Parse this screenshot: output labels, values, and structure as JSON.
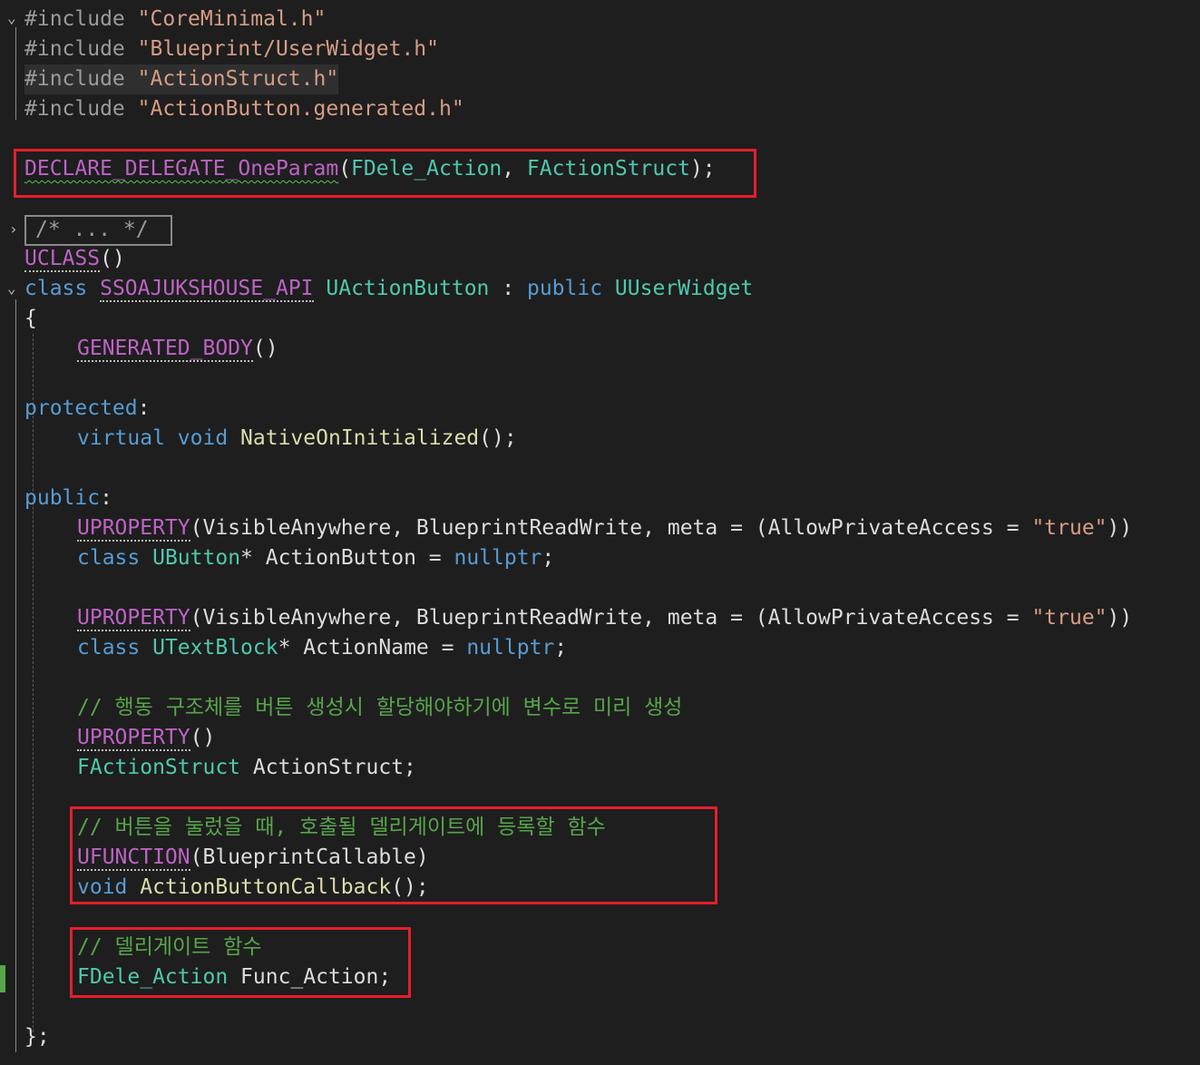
{
  "editor": {
    "include_keyword": "#include",
    "includes": [
      "\"CoreMinimal.h\"",
      "\"Blueprint/UserWidget.h\"",
      "\"ActionStruct.h\"",
      "\"ActionButton.generated.h\""
    ],
    "declare_macro": "DECLARE_DELEGATE_OneParam",
    "declare_args": [
      "FDele_Action",
      "FActionStruct"
    ],
    "collapsed_comment": "/* ... */",
    "uclass": "UCLASS",
    "class_keyword": "class",
    "api_macro": "SSOAJUKSHOUSE_API",
    "class_name": "UActionButton",
    "public_keyword": "public",
    "base_class": "UUserWidget",
    "generated_body": "GENERATED_BODY",
    "protected_label": "protected",
    "virtual_keyword": "virtual",
    "void_keyword": "void",
    "native_on_initialized": "NativeOnInitialized",
    "public_label": "public",
    "uproperty": "UPROPERTY",
    "visible_anywhere": "VisibleAnywhere",
    "blueprint_read_write": "BlueprintReadWrite",
    "meta": "meta",
    "allow_private_access": "AllowPrivateAccess",
    "true_string": "\"true\"",
    "ubutton": "UButton",
    "action_button_var": "ActionButton",
    "nullptr": "nullptr",
    "utextblock": "UTextBlock",
    "action_name_var": "ActionName",
    "comment_struct": "// 행동 구조체를 버튼 생성시 할당해야하기에 변수로 미리 생성",
    "faction_struct": "FActionStruct",
    "action_struct_var": "ActionStruct",
    "comment_callback": "// 버튼을 눌렀을 때, 호출될 델리게이트에 등록할 함수",
    "ufunction": "UFUNCTION",
    "blueprint_callable": "BlueprintCallable",
    "callback_fn": "ActionButtonCallback",
    "comment_delegate": "// 델리게이트 함수",
    "delegate_type": "FDele_Action",
    "func_action_var": "Func_Action",
    "closing": "};"
  },
  "colors": {
    "background": "#1e1e1e",
    "keyword": "#569cd6",
    "string": "#d69d85",
    "macro": "#bd63c5",
    "type": "#4ec9b0",
    "function": "#dcdcaa",
    "comment": "#57a64a",
    "highlight_box": "#e51f2b"
  }
}
